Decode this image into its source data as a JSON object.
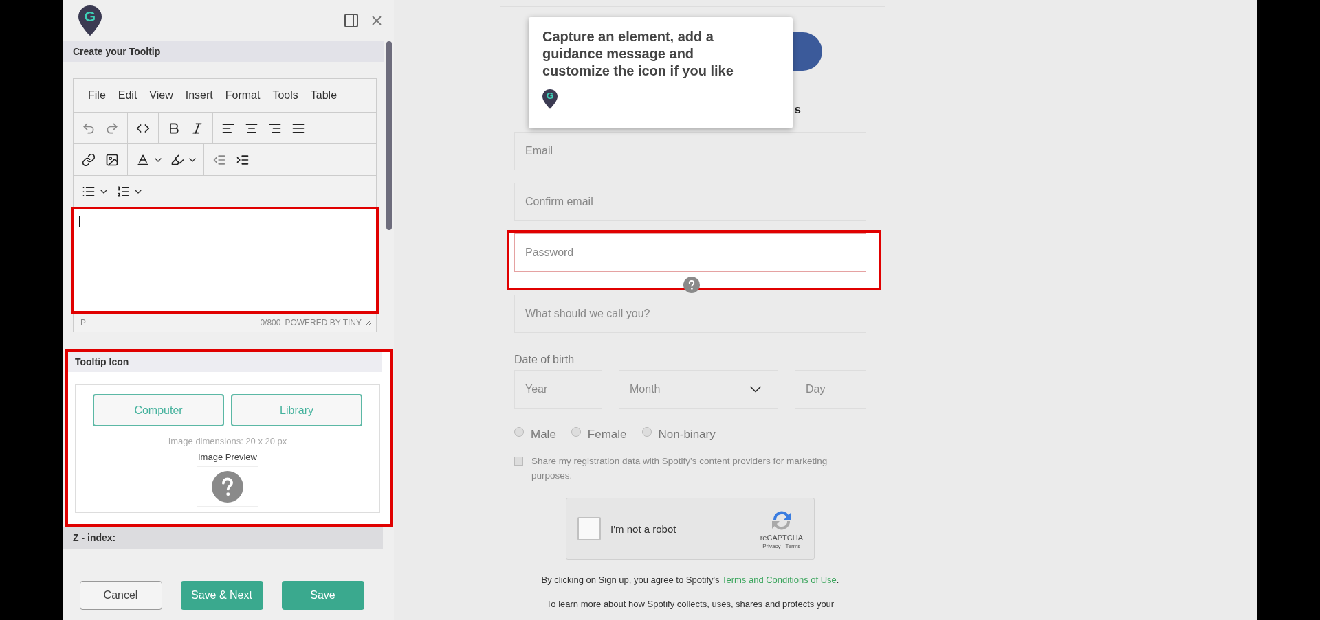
{
  "panel": {
    "logo_letter": "G",
    "title": "Create your Tooltip",
    "editor": {
      "menu": [
        "File",
        "Edit",
        "View",
        "Insert",
        "Format",
        "Tools",
        "Table"
      ],
      "highlighted": true,
      "element_path": "P",
      "count": "0/800",
      "brand": "POWERED BY TINY"
    },
    "icon_section": {
      "title": "Tooltip Icon",
      "highlighted": true,
      "buttons": [
        "Computer",
        "Library"
      ],
      "hint": "Image dimensions: 20 x 20 px",
      "preview_label": "Image Preview"
    },
    "zindex_title": "Z - index:",
    "footer_buttons": [
      {
        "label": "Cancel",
        "kind": "secondary"
      },
      {
        "label": "Save & Next",
        "kind": "primary"
      },
      {
        "label": "Save",
        "kind": "primary"
      }
    ]
  },
  "page": {
    "tooltip": {
      "message": "Capture an element, add a guidance message and customize the icon if you like",
      "logo_letter": "G"
    },
    "heading_fragment": "s",
    "fields": [
      {
        "placeholder": "Email",
        "highlighted": false
      },
      {
        "placeholder": "Confirm email",
        "highlighted": false
      },
      {
        "placeholder": "Password",
        "highlighted": true
      },
      {
        "placeholder": "What should we call you?",
        "highlighted": false
      }
    ],
    "dob_label": "Date of birth",
    "dob_fields": [
      {
        "placeholder": "Year",
        "kind": "input"
      },
      {
        "placeholder": "Month",
        "kind": "select"
      },
      {
        "placeholder": "Day",
        "kind": "input"
      }
    ],
    "genders": [
      {
        "label": "Male",
        "selected": false
      },
      {
        "label": "Female",
        "selected": false
      },
      {
        "label": "Non-binary",
        "selected": false
      }
    ],
    "share": {
      "label": "Share my registration data with Spotify's content providers for marketing purposes.",
      "checked": false
    },
    "captcha": {
      "label": "I'm not a robot",
      "checked": false,
      "brand": "reCAPTCHA",
      "links": "Privacy - Terms"
    },
    "terms": {
      "before": "By clicking on Sign up, you agree to Spotify's ",
      "link": "Terms and Conditions of Use",
      "after": "."
    },
    "privacy_line": "To learn more about how Spotify collects, uses, shares and protects your"
  }
}
